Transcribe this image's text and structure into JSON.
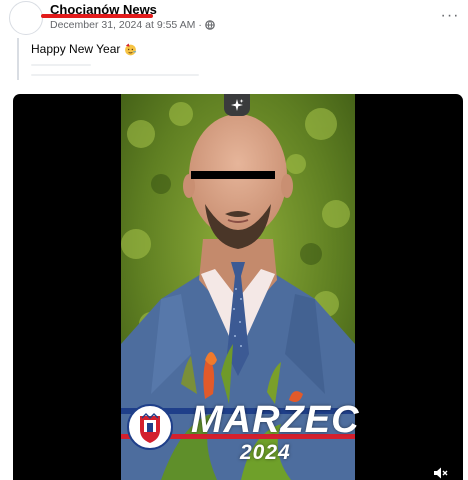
{
  "post": {
    "page_name": "Chocianów News",
    "timestamp": "December 31, 2024 at 9:55 AM",
    "separator": "·",
    "text": "Happy New Year",
    "more_label": "···"
  },
  "video": {
    "overlay_title": "MARZEC",
    "overlay_year": "2024"
  },
  "icons": {
    "avatar": "avatar-placeholder",
    "privacy": "globe-icon",
    "emoji": "partying-face-emoji-icon",
    "more": "more-options-icon",
    "sparkle": "sparkle-icon",
    "volume": "volume-icon"
  },
  "colors": {
    "highlight_underline": "#e21b1b",
    "text_primary": "#050505",
    "text_secondary": "#65676b",
    "video_background": "#000000",
    "banner_blue": "#1f3f8a",
    "banner_red": "#d3202e"
  }
}
